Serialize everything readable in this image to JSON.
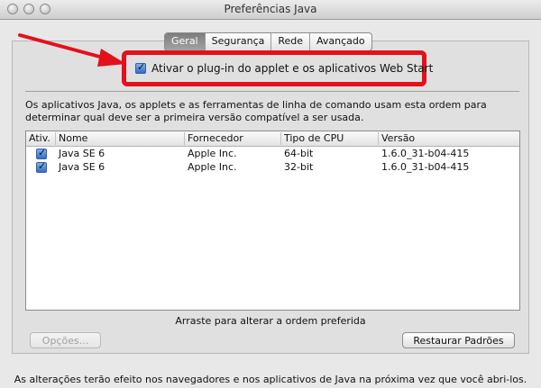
{
  "window": {
    "title": "Preferências Java"
  },
  "tabs": [
    {
      "label": "Geral"
    },
    {
      "label": "Segurança"
    },
    {
      "label": "Rede"
    },
    {
      "label": "Avançado"
    }
  ],
  "general": {
    "enable_checkbox_label": "Ativar o plug-in do applet e os aplicativos Web Start",
    "enable_checked": true,
    "description": "Os aplicativos Java, os applets e as ferramentas de linha de comando usam esta ordem para determinar qual deve ser a primeira versão compatível a ser usada.",
    "table": {
      "headers": [
        "Ativ.",
        "Nome",
        "Fornecedor",
        "Tipo de CPU",
        "Versão"
      ],
      "rows": [
        {
          "active": true,
          "name": "Java SE 6",
          "vendor": "Apple Inc.",
          "cpu": "64-bit",
          "version": "1.6.0_31-b04-415"
        },
        {
          "active": true,
          "name": "Java SE 6",
          "vendor": "Apple Inc.",
          "cpu": "32-bit",
          "version": "1.6.0_31-b04-415"
        }
      ]
    },
    "drag_hint": "Arraste para alterar a ordem preferida",
    "options_button": "Opções...",
    "restore_button": "Restaurar Padrões",
    "footer_note": "As alterações terão efeito nos navegadores e nos aplicativos de Java na próxima vez que você abri-los."
  },
  "colors": {
    "callout": "#e3111b",
    "active_tab": "#8f8f8f",
    "checkbox": "#2f6fc8"
  }
}
